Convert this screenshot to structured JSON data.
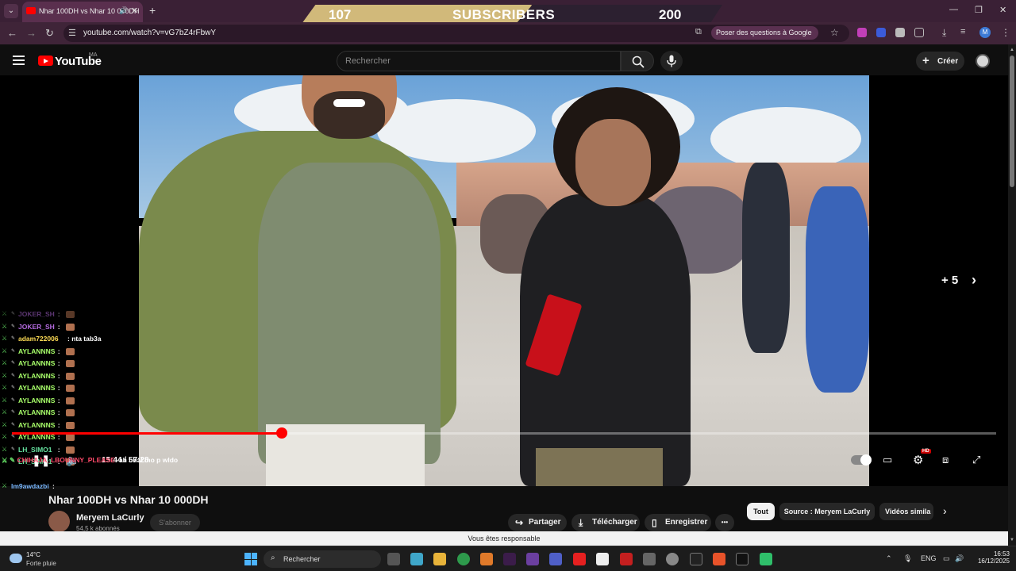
{
  "browser": {
    "tab_title": "Nhar 100DH vs Nhar 10 000DH",
    "tab_speaker_icon": "speaker-icon",
    "url": "youtube.com/watch?v=vG7bZ4rFbwY",
    "ask_google": "Poser des questions à Google",
    "profile_initial": "M",
    "new_tab": "+",
    "close_tab": "✕"
  },
  "subscriber_banner": {
    "current": "107",
    "label": "SUBSCRIBERS",
    "goal": "200"
  },
  "youtube": {
    "logo_text": "YouTube",
    "region": "MA",
    "search_placeholder": "Rechercher",
    "create_label": "Créer"
  },
  "player": {
    "more_label": "+ 5",
    "time": "15:44 / 57:28",
    "progress_fraction": 0.274,
    "controls": [
      "play-pause-icon",
      "volume-icon",
      "autoplay-toggle",
      "subtitles-icon",
      "settings-icon",
      "miniplayer-icon",
      "fullscreen-icon"
    ],
    "hd_badge": "HD"
  },
  "chat": {
    "messages": [
      {
        "user": "JOKER_SH",
        "color": "#b46adf",
        "text": ":",
        "emote": true,
        "dim": true
      },
      {
        "user": "JOKER_SH",
        "color": "#b46adf",
        "text": ":",
        "emote": true,
        "dim": false
      },
      {
        "user": "adam722006",
        "color": "#ffdd55",
        "text": ": nta tab3a",
        "emote": false,
        "dim": false
      },
      {
        "user": "AYLANNNS",
        "color": "#a8ff6a",
        "text": ":",
        "emote": true,
        "dim": false
      },
      {
        "user": "AYLANNNS",
        "color": "#a8ff6a",
        "text": ":",
        "emote": true,
        "dim": false
      },
      {
        "user": "AYLANNNS",
        "color": "#a8ff6a",
        "text": ":",
        "emote": true,
        "dim": false
      },
      {
        "user": "AYLANNNS",
        "color": "#a8ff6a",
        "text": ":",
        "emote": true,
        "dim": false
      },
      {
        "user": "AYLANNNS",
        "color": "#a8ff6a",
        "text": ":",
        "emote": true,
        "dim": false
      },
      {
        "user": "AYLANNNS",
        "color": "#a8ff6a",
        "text": ":",
        "emote": true,
        "dim": false
      },
      {
        "user": "AYLANNNS",
        "color": "#a8ff6a",
        "text": ":",
        "emote": true,
        "dim": false
      },
      {
        "user": "AYLANNNS",
        "color": "#a8ff6a",
        "text": ":",
        "emote": true,
        "dim": false
      },
      {
        "user": "LH_SIMO1",
        "color": "#66e3a0",
        "text": ":",
        "emote": true,
        "dim": false
      },
      {
        "user": "LH_SIMO1",
        "color": "#66e3a0",
        "text": ":",
        "emote": true,
        "dim": false
      }
    ],
    "overlap_line": {
      "user": "CHIHAJA_LBOUNNY_PLEASE",
      "color": "#ff4a6a",
      "text": ": ah bhal mo p wldo"
    },
    "last_line": {
      "user": "lm9awdazbi",
      "color": "#7ab8ff",
      "text": ":"
    }
  },
  "video_info": {
    "title": "Nhar 100DH vs Nhar 10 000DH",
    "channel": "Meryem LaCurly",
    "subscribers": "54,5 k abonnés",
    "subscribe_label": "S'abonner",
    "share_label": "Partager",
    "download_label": "Télécharger",
    "save_label": "Enregistrer",
    "more_label": "•••"
  },
  "chips": [
    "Tout",
    "Source : Meryem LaCurly",
    "Vidéos simila"
  ],
  "notice": "Vous êtes responsable",
  "taskbar": {
    "weather_temp": "14°C",
    "weather_desc": "Forte pluie",
    "search": "Rechercher",
    "lang": "ENG",
    "time": "16:53",
    "date": "16/12/2025"
  }
}
